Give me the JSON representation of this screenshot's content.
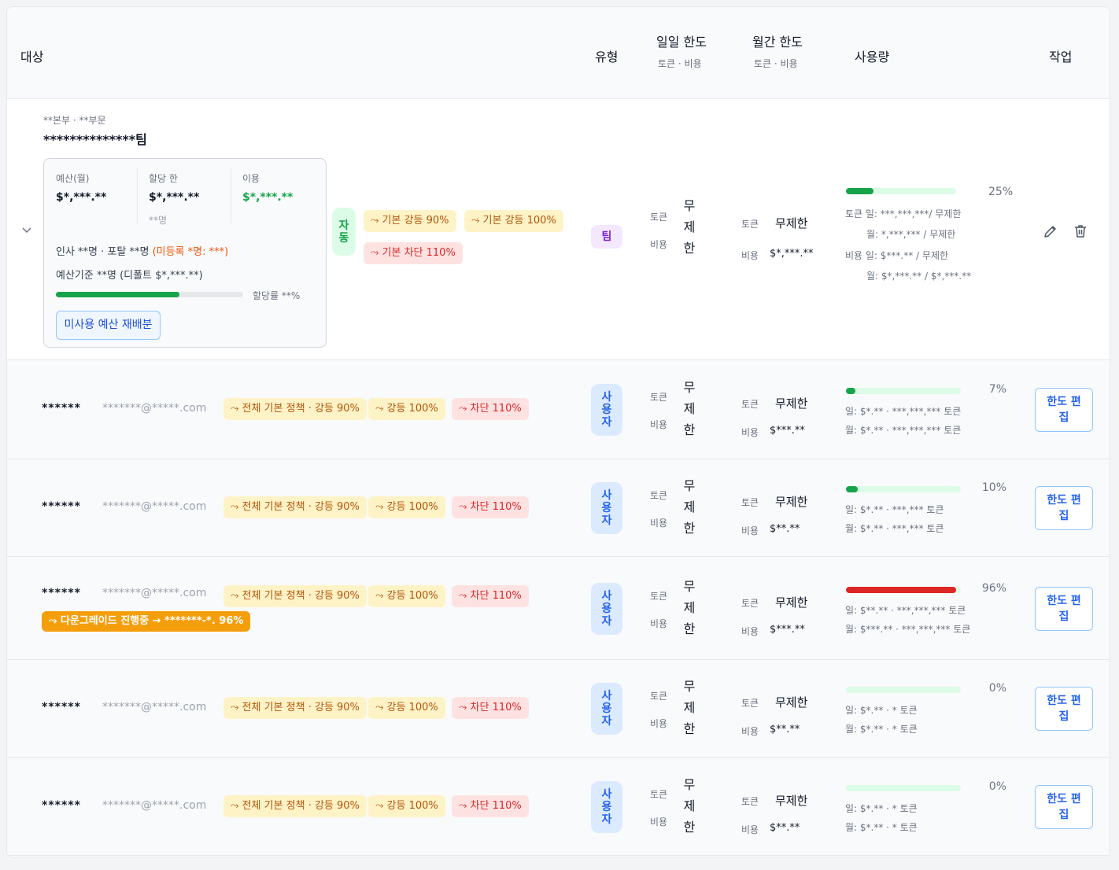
{
  "header": {
    "target": "대상",
    "type": "유형",
    "daily_limit": "일일 한도",
    "daily_sub": "토큰 · 비용",
    "monthly_limit": "월간 한도",
    "monthly_sub": "토큰 · 비용",
    "usage": "사용량",
    "action": "작업"
  },
  "team": {
    "org_path": "**본부 · **부문",
    "name": "**************팀",
    "card": {
      "budget_label": "예산(월)",
      "budget_value": "$*,***.**",
      "alloc_label": "할당 한",
      "alloc_value": "$*,***.**",
      "alloc_sub": "**명",
      "used_label": "이용",
      "used_value": "$*,***.**",
      "members_line": "인사 **명 · 포탈 **명",
      "unregistered": "(미등록 *명: ***)",
      "budget_basis": "예산기준 **명 (디폴트 $*,***.**)",
      "alloc_rate_label": "할당률 **%",
      "alloc_rate": 0.66,
      "redistribute_button": "미사용 예산 재배분"
    },
    "policy_badge": [
      "자",
      "동"
    ],
    "policies": [
      "⤳ 기본 강등 90%",
      "⤳ 기본 강등 100%",
      "⤳ 기본 차단 110%"
    ],
    "type_badge": "팀",
    "daily": {
      "token_label": "토큰",
      "cost_label": "비용",
      "value_chars": [
        "무",
        "제",
        "한"
      ]
    },
    "monthly": {
      "token_label": "토큰",
      "token_value": "무제한",
      "cost_label": "비용",
      "cost_value": "$*,***.**"
    },
    "usage": {
      "percent_text": "25%",
      "percent": 0.25,
      "lines": [
        "토큰 일: ***,***,***/ 무제한",
        "월: *,***,*** / 무제한",
        "비용 일: $***.** / 무제한",
        "월: $*,***.** / $*,***.**"
      ]
    },
    "edit_icon": "pencil-icon",
    "delete_icon": "trash-icon",
    "expand_icon": "chevron-down-icon"
  },
  "users": [
    {
      "name": "******",
      "email": "*******@*****.com",
      "policies": [
        "⤳ 전체 기본 정책 · 강등 90%",
        "⤳ 강등 100%",
        "⤳ 차단 110%"
      ],
      "downgrade": "",
      "type_chars": [
        "사",
        "용",
        "자"
      ],
      "daily_token_label": "토큰",
      "daily_cost_label": "비용",
      "daily_chars": [
        "무",
        "제",
        "한"
      ],
      "monthly_token_label": "토큰",
      "monthly_token_value": "무제한",
      "monthly_cost_label": "비용",
      "monthly_cost_value": "$***.**",
      "percent_text": "7%",
      "percent": 0.07,
      "usage_day": "일: $*.** · ***,***,*** 토큰",
      "usage_month": "월: $*.** · ***,***,*** 토큰",
      "edit_button": "한도 편집"
    },
    {
      "name": "******",
      "email": "*******@*****.com",
      "policies": [
        "⤳ 전체 기본 정책 · 강등 90%",
        "⤳ 강등 100%",
        "⤳ 차단 110%"
      ],
      "downgrade": "",
      "type_chars": [
        "사",
        "용",
        "자"
      ],
      "daily_token_label": "토큰",
      "daily_cost_label": "비용",
      "daily_chars": [
        "무",
        "제",
        "한"
      ],
      "monthly_token_label": "토큰",
      "monthly_token_value": "무제한",
      "monthly_cost_label": "비용",
      "monthly_cost_value": "$**.**",
      "percent_text": "10%",
      "percent": 0.1,
      "usage_day": "일: $*.** · ***,*** 토큰",
      "usage_month": "월: $*.** · ***,*** 토큰",
      "edit_button": "한도 편집"
    },
    {
      "name": "******",
      "email": "*******@*****.com",
      "policies": [
        "⤳ 전체 기본 정책 · 강등 90%",
        "⤳ 강등 100%",
        "⤳ 차단 110%"
      ],
      "downgrade": "⤳ 다운그레이드 진행중 → *******-*. 96%",
      "type_chars": [
        "사",
        "용",
        "자"
      ],
      "daily_token_label": "토큰",
      "daily_cost_label": "비용",
      "daily_chars": [
        "무",
        "제",
        "한"
      ],
      "monthly_token_label": "토큰",
      "monthly_token_value": "무제한",
      "monthly_cost_label": "비용",
      "monthly_cost_value": "$***.**",
      "percent_text": "96%",
      "percent": 0.96,
      "usage_day": "일: $**.** · ***,***,*** 토큰",
      "usage_month": "월: $***.** · ***,***,*** 토큰",
      "edit_button": "한도 편집"
    },
    {
      "name": "******",
      "email": "*******@*****.com",
      "policies": [
        "⤳ 전체 기본 정책 · 강등 90%",
        "⤳ 강등 100%",
        "⤳ 차단 110%"
      ],
      "downgrade": "",
      "type_chars": [
        "사",
        "용",
        "자"
      ],
      "daily_token_label": "토큰",
      "daily_cost_label": "비용",
      "daily_chars": [
        "무",
        "제",
        "한"
      ],
      "monthly_token_label": "토큰",
      "monthly_token_value": "무제한",
      "monthly_cost_label": "비용",
      "monthly_cost_value": "$**.**",
      "percent_text": "0%",
      "percent": 0.0,
      "usage_day": "일: $*.** · * 토큰",
      "usage_month": "월: $*.** · * 토큰",
      "edit_button": "한도 편집"
    },
    {
      "name": "******",
      "email": "*******@*****.com",
      "policies": [
        "⤳ 전체 기본 정책 · 강등 90%",
        "⤳ 강등 100%",
        "⤳ 차단 110%"
      ],
      "downgrade": "",
      "type_chars": [
        "사",
        "용",
        "자"
      ],
      "daily_token_label": "토큰",
      "daily_cost_label": "비용",
      "daily_chars": [
        "무",
        "제",
        "한"
      ],
      "monthly_token_label": "토큰",
      "monthly_token_value": "무제한",
      "monthly_cost_label": "비용",
      "monthly_cost_value": "$**.**",
      "percent_text": "0%",
      "percent": 0.0,
      "usage_day": "일: $*.** · * 토큰",
      "usage_month": "월: $*.** · * 토큰",
      "edit_button": "한도 편집"
    }
  ],
  "colors": {
    "green": "#16a34a",
    "red": "#dc2626",
    "blue": "#2563eb",
    "amber_bg": "#fef3c7",
    "red_bg": "#fee2e2",
    "orange": "#f59e0b",
    "purple_bg": "#f3e8ff"
  }
}
